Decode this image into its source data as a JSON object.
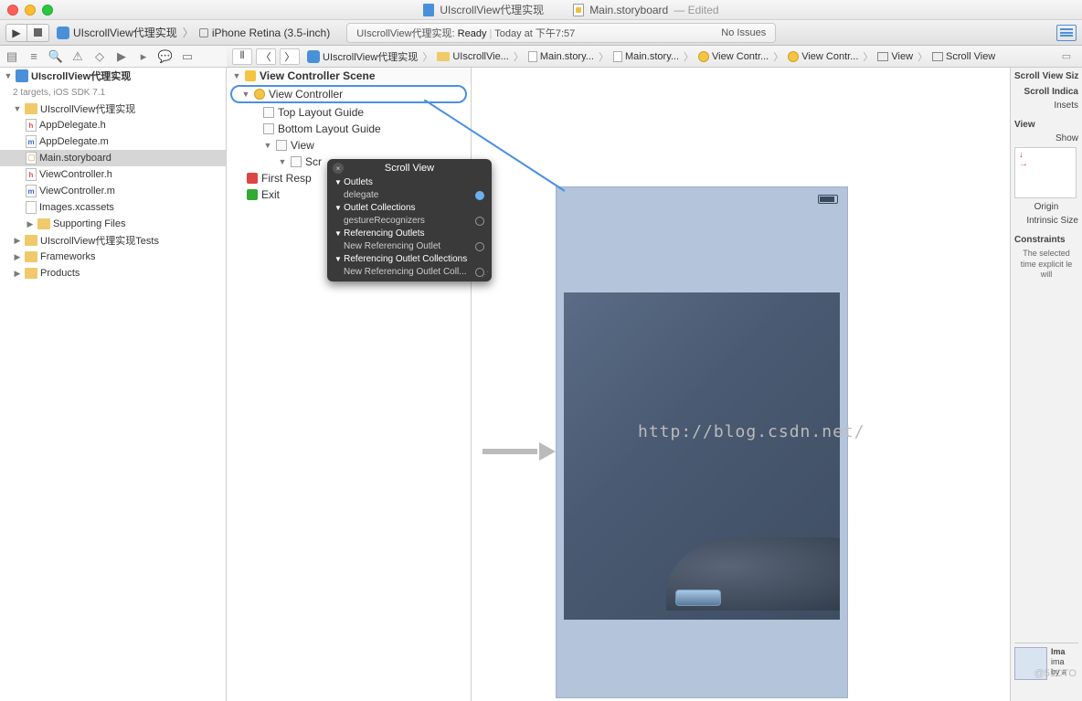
{
  "window": {
    "tab1": "UIscrollView代理实现",
    "tab2": "Main.storyboard",
    "tab2_suffix": "— Edited"
  },
  "toolbar": {
    "scheme_project": "UIscrollView代理实现",
    "scheme_device": "iPhone Retina (3.5-inch)"
  },
  "status": {
    "project": "UIscrollView代理实现:",
    "state": "Ready",
    "time": "Today at 下午7:57",
    "issues": "No Issues"
  },
  "jumpbar": {
    "items": [
      "UIscrollView代理实现",
      "UIscrollVie...",
      "Main.story...",
      "Main.story...",
      "View Contr...",
      "View Contr...",
      "View",
      "Scroll View"
    ]
  },
  "nav": {
    "project": "UIscrollView代理实现",
    "targets": "2 targets, iOS SDK 7.1",
    "group": "UIscrollView代理实现",
    "files": [
      "AppDelegate.h",
      "AppDelegate.m",
      "Main.storyboard",
      "ViewController.h",
      "ViewController.m",
      "Images.xcassets"
    ],
    "supporting": "Supporting Files",
    "tests": "UIscrollView代理实现Tests",
    "frameworks": "Frameworks",
    "products": "Products"
  },
  "outline": {
    "scene": "View Controller Scene",
    "vc": "View Controller",
    "top": "Top Layout Guide",
    "bottom": "Bottom Layout Guide",
    "view": "View",
    "scroll": "Scr",
    "first": "First Resp",
    "exit": "Exit"
  },
  "popover": {
    "title": "Scroll View",
    "sec1": "Outlets",
    "item1": "delegate",
    "sec2": "Outlet Collections",
    "item2": "gestureRecognizers",
    "sec3": "Referencing Outlets",
    "item3": "New Referencing Outlet",
    "sec4": "Referencing Outlet Collections",
    "item4": "New Referencing Outlet Coll..."
  },
  "inspector": {
    "title": "Scroll View Siz",
    "indic": "Scroll Indica",
    "insets": "Insets",
    "view": "View",
    "show": "Show",
    "origin": "Origin",
    "intrinsic": "Intrinsic Size",
    "constraints": "Constraints",
    "ctext": "The selected time explicit le will",
    "ima": "Ima",
    "ima2": "ima",
    "by": "by a"
  },
  "watermark": "http://blog.csdn.net/",
  "credit": "@51CTO"
}
